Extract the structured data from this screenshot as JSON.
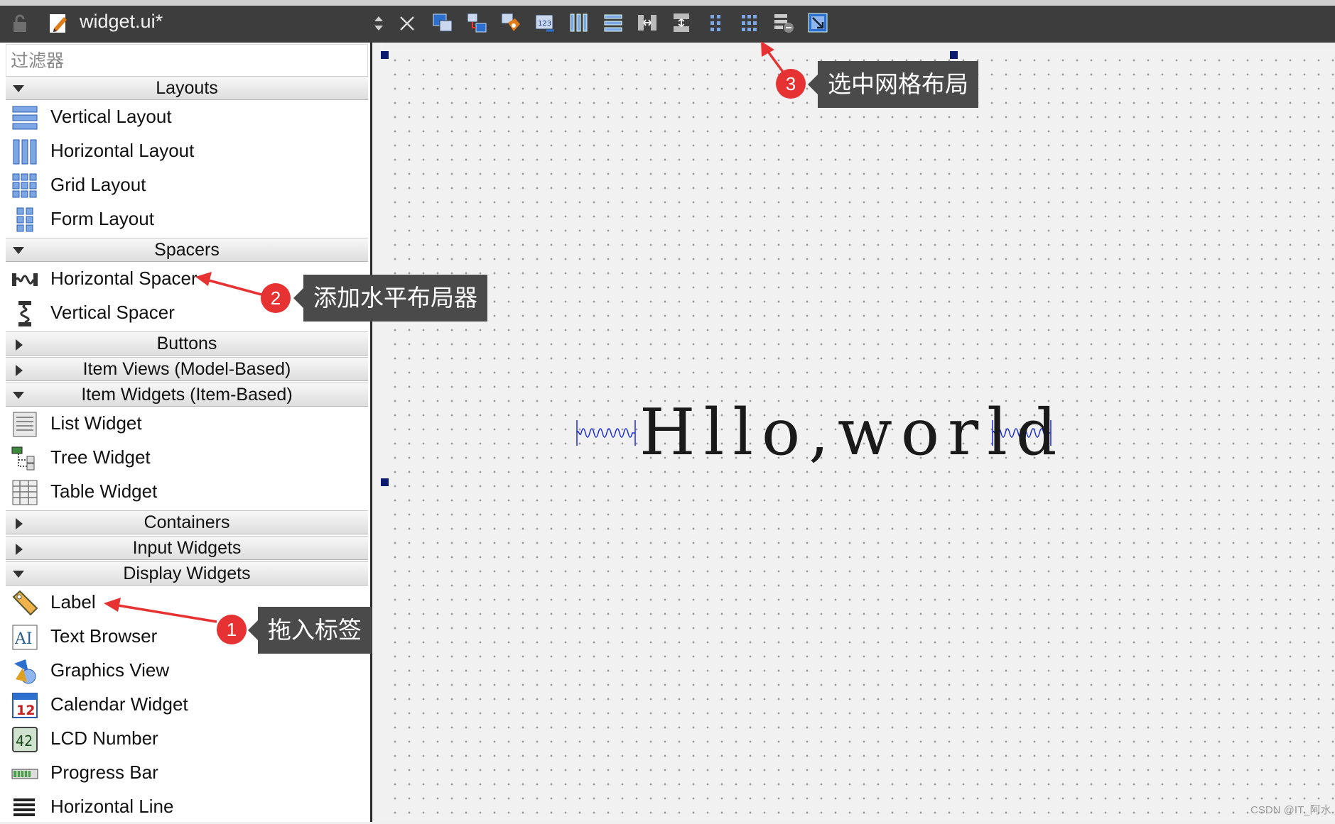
{
  "toolbar": {
    "file_name": "widget.ui*",
    "tool_icons": [
      "edit-widgets-icon",
      "edit-signals-slots-icon",
      "edit-buddies-icon",
      "edit-tab-order-icon",
      "layout-horizontal-icon",
      "layout-vertical-icon",
      "layout-horizontal-splitter-icon",
      "layout-vertical-splitter-icon",
      "layout-form-icon",
      "layout-grid-icon",
      "break-layout-icon",
      "adjust-size-icon"
    ]
  },
  "sidebar": {
    "filter_placeholder": "过滤器",
    "categories": {
      "layouts": "Layouts",
      "spacers": "Spacers",
      "buttons": "Buttons",
      "item_views": "Item Views (Model-Based)",
      "item_widgets": "Item Widgets (Item-Based)",
      "containers": "Containers",
      "input_widgets": "Input Widgets",
      "display_widgets": "Display Widgets"
    },
    "items": {
      "vertical_layout": "Vertical Layout",
      "horizontal_layout": "Horizontal Layout",
      "grid_layout": "Grid Layout",
      "form_layout": "Form Layout",
      "horizontal_spacer": "Horizontal Spacer",
      "vertical_spacer": "Vertical Spacer",
      "list_widget": "List Widget",
      "tree_widget": "Tree Widget",
      "table_widget": "Table Widget",
      "label": "Label",
      "text_browser": "Text Browser",
      "graphics_view": "Graphics View",
      "calendar_widget": "Calendar Widget",
      "lcd_number": "LCD Number",
      "progress_bar": "Progress Bar",
      "horizontal_line": "Horizontal Line"
    }
  },
  "canvas": {
    "label_text": "Hllo,world"
  },
  "annotations": [
    {
      "number": "1",
      "text": "拖入标签"
    },
    {
      "number": "2",
      "text": "添加水平布局器"
    },
    {
      "number": "3",
      "text": "选中网格布局"
    }
  ],
  "watermark": "CSDN @IT_阿水",
  "colors": {
    "toolbar_bg": "#3d3d3d",
    "callout_bg": "#4a4a4a",
    "badge_red": "#e63232",
    "arrow_red": "#e63232",
    "spacer_blue": "#1a2bd6",
    "handle_navy": "#0a1a6e"
  }
}
